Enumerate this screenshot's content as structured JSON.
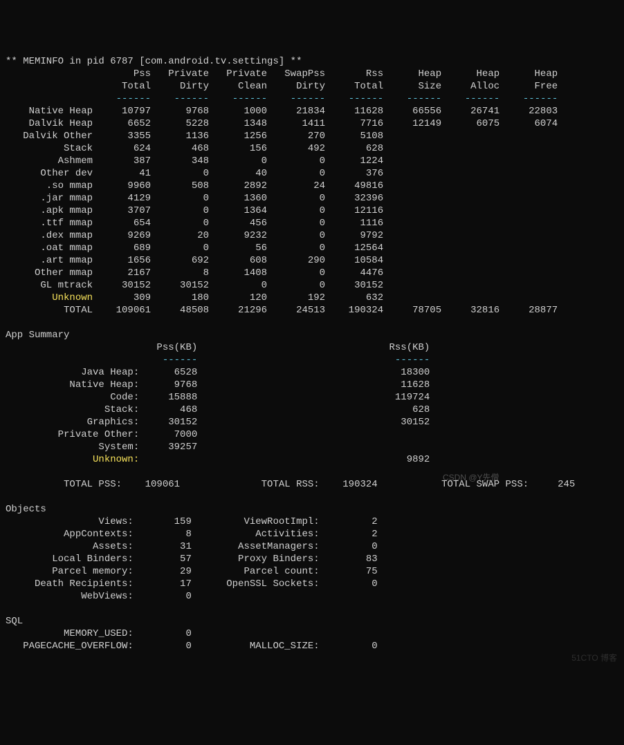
{
  "title": "** MEMINFO in pid 6787 [com.android.tv.settings] **",
  "cols": {
    "c0l1": "Pss",
    "c0l2": "Total",
    "c1l1": "Private",
    "c1l2": "Dirty",
    "c2l1": "Private",
    "c2l2": "Clean",
    "c3l1": "SwapPss",
    "c3l2": "Dirty",
    "c4l1": "Rss",
    "c4l2": "Total",
    "c5l1": "Heap",
    "c5l2": "Size",
    "c6l1": "Heap",
    "c6l2": "Alloc",
    "c7l1": "Heap",
    "c7l2": "Free"
  },
  "sep6": "------",
  "rows": [
    {
      "n": "Native Heap",
      "v": [
        "10797",
        "9768",
        "1000",
        "21834",
        "11628",
        "66556",
        "26741",
        "22803"
      ],
      "hl": false
    },
    {
      "n": "Dalvik Heap",
      "v": [
        "6652",
        "5228",
        "1348",
        "1411",
        "7716",
        "12149",
        "6075",
        "6074"
      ],
      "hl": false
    },
    {
      "n": "Dalvik Other",
      "v": [
        "3355",
        "1136",
        "1256",
        "270",
        "5108",
        "",
        "",
        ""
      ],
      "hl": false
    },
    {
      "n": "Stack",
      "v": [
        "624",
        "468",
        "156",
        "492",
        "628",
        "",
        "",
        ""
      ],
      "hl": false
    },
    {
      "n": "Ashmem",
      "v": [
        "387",
        "348",
        "0",
        "0",
        "1224",
        "",
        "",
        ""
      ],
      "hl": false
    },
    {
      "n": "Other dev",
      "v": [
        "41",
        "0",
        "40",
        "0",
        "376",
        "",
        "",
        ""
      ],
      "hl": false
    },
    {
      "n": ".so mmap",
      "v": [
        "9960",
        "508",
        "2892",
        "24",
        "49816",
        "",
        "",
        ""
      ],
      "hl": false
    },
    {
      "n": ".jar mmap",
      "v": [
        "4129",
        "0",
        "1360",
        "0",
        "32396",
        "",
        "",
        ""
      ],
      "hl": false
    },
    {
      "n": ".apk mmap",
      "v": [
        "3707",
        "0",
        "1364",
        "0",
        "12116",
        "",
        "",
        ""
      ],
      "hl": false
    },
    {
      "n": ".ttf mmap",
      "v": [
        "654",
        "0",
        "456",
        "0",
        "1116",
        "",
        "",
        ""
      ],
      "hl": false
    },
    {
      "n": ".dex mmap",
      "v": [
        "9269",
        "20",
        "9232",
        "0",
        "9792",
        "",
        "",
        ""
      ],
      "hl": false
    },
    {
      "n": ".oat mmap",
      "v": [
        "689",
        "0",
        "56",
        "0",
        "12564",
        "",
        "",
        ""
      ],
      "hl": false
    },
    {
      "n": ".art mmap",
      "v": [
        "1656",
        "692",
        "608",
        "290",
        "10584",
        "",
        "",
        ""
      ],
      "hl": false
    },
    {
      "n": "Other mmap",
      "v": [
        "2167",
        "8",
        "1408",
        "0",
        "4476",
        "",
        "",
        ""
      ],
      "hl": false
    },
    {
      "n": "GL mtrack",
      "v": [
        "30152",
        "30152",
        "0",
        "0",
        "30152",
        "",
        "",
        ""
      ],
      "hl": false
    },
    {
      "n": "Unknown",
      "v": [
        "309",
        "180",
        "120",
        "192",
        "632",
        "",
        "",
        ""
      ],
      "hl": true
    },
    {
      "n": "TOTAL",
      "v": [
        "109061",
        "48508",
        "21296",
        "24513",
        "190324",
        "78705",
        "32816",
        "28877"
      ],
      "hl": false
    }
  ],
  "appSummary": {
    "title": "App Summary",
    "hdrPss": "Pss(KB)",
    "hdrRss": "Rss(KB)",
    "rows": [
      {
        "n": "Java Heap:",
        "p": "6528",
        "r": "18300",
        "hl": false
      },
      {
        "n": "Native Heap:",
        "p": "9768",
        "r": "11628",
        "hl": false
      },
      {
        "n": "Code:",
        "p": "15888",
        "r": "119724",
        "hl": false
      },
      {
        "n": "Stack:",
        "p": "468",
        "r": "628",
        "hl": false
      },
      {
        "n": "Graphics:",
        "p": "30152",
        "r": "30152",
        "hl": false
      },
      {
        "n": "Private Other:",
        "p": "7000",
        "r": "",
        "hl": false
      },
      {
        "n": "System:",
        "p": "39257",
        "r": "",
        "hl": false
      },
      {
        "n": "Unknown:",
        "p": "",
        "r": "9892",
        "hl": true
      }
    ],
    "totals": {
      "lblPss": "TOTAL PSS:",
      "valPss": "109061",
      "lblRss": "TOTAL RSS:",
      "valRss": "190324",
      "lblSwap": "TOTAL SWAP PSS:",
      "valSwap": "245"
    }
  },
  "objects": {
    "title": "Objects",
    "pairs": [
      {
        "l": "Views:",
        "lv": "159",
        "r": "ViewRootImpl:",
        "rv": "2"
      },
      {
        "l": "AppContexts:",
        "lv": "8",
        "r": "Activities:",
        "rv": "2"
      },
      {
        "l": "Assets:",
        "lv": "31",
        "r": "AssetManagers:",
        "rv": "0"
      },
      {
        "l": "Local Binders:",
        "lv": "57",
        "r": "Proxy Binders:",
        "rv": "83"
      },
      {
        "l": "Parcel memory:",
        "lv": "29",
        "r": "Parcel count:",
        "rv": "75"
      },
      {
        "l": "Death Recipients:",
        "lv": "17",
        "r": "OpenSSL Sockets:",
        "rv": "0"
      },
      {
        "l": "WebViews:",
        "lv": "0",
        "r": "",
        "rv": ""
      }
    ]
  },
  "sql": {
    "title": "SQL",
    "pairs": [
      {
        "l": "MEMORY_USED:",
        "lv": "0",
        "r": "",
        "rv": ""
      },
      {
        "l": "PAGECACHE_OVERFLOW:",
        "lv": "0",
        "r": "MALLOC_SIZE:",
        "rv": "0"
      }
    ]
  },
  "watermark1": "CSDN @Y先僧",
  "watermark2": "51CTO 博客"
}
